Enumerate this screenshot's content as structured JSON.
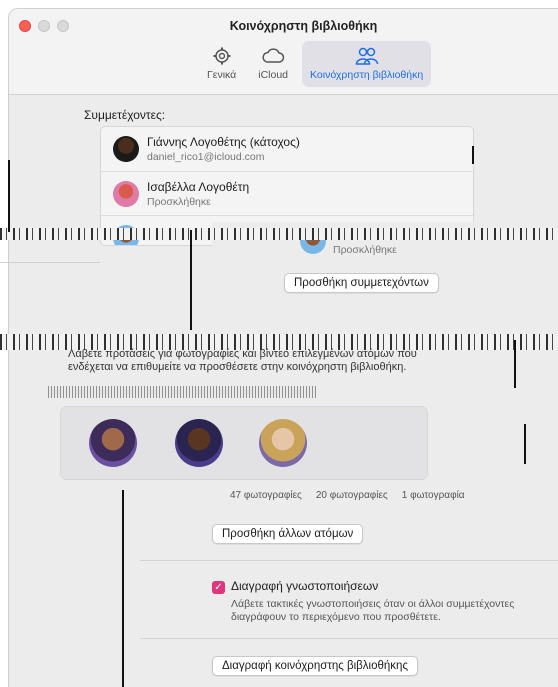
{
  "window": {
    "title": "Κοινόχρηστη βιβλιοθήκη"
  },
  "tabs": [
    {
      "label": "Γενικά",
      "icon": "gear-icon"
    },
    {
      "label": "iCloud",
      "icon": "cloud-icon"
    },
    {
      "label": "Κοινόχρηστη βιβλιοθήκη",
      "icon": "people-icon"
    }
  ],
  "participants": {
    "heading": "Συμμετέχοντες:",
    "rows": [
      {
        "name": "Γιάννης Λογοθέτης (κάτοχος)",
        "sub": "daniel_rico1@icloud.com"
      },
      {
        "name": "Ισαβέλλα Λογοθέτη",
        "sub": "Προσκλήθηκε"
      },
      {
        "name": "",
        "sub": "Προσκλήθηκε"
      }
    ],
    "add_button": "Προσθήκη συμμετεχόντων"
  },
  "suggestions": {
    "text": "Λάβετε προτάσεις για φωτογραφίες και βίντεο επιλεγμένων ατόμων που ενδέχεται να επιθυμείτε να προσθέσετε στην κοινόχρηστη βιβλιοθήκη."
  },
  "counts": [
    "47 φωτογραφίες",
    "20 φωτογραφίες",
    "1 φωτογραφία"
  ],
  "add_others_button": "Προσθήκη άλλων ατόμων",
  "notifications": {
    "title": "Διαγραφή γνωστοποιήσεων",
    "description": "Λάβετε τακτικές γνωστοποιήσεις όταν οι άλλοι συμμετέχοντες διαγράφουν το περιεχόμενο που προσθέτετε.",
    "checked": true
  },
  "delete_button": "Διαγραφή κοινόχρηστης βιβλιοθήκης"
}
